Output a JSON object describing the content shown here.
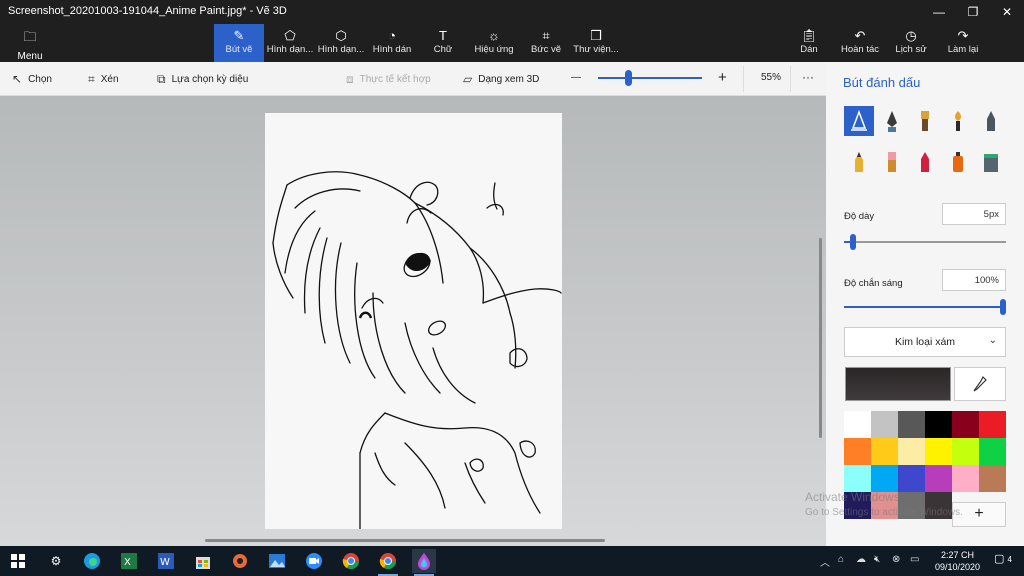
{
  "window": {
    "title": "Screenshot_20201003-191044_Anime Paint.jpg* - Vẽ 3D",
    "minimize": "—",
    "restore": "❐",
    "close": "✕"
  },
  "ribbon": {
    "menu_label": "Menu",
    "tools": [
      {
        "label": "Bút vẽ",
        "icon": "brush-icon"
      },
      {
        "label": "Hình dạn...",
        "icon": "2d-shapes-icon"
      },
      {
        "label": "Hình dạn...",
        "icon": "3d-shapes-icon"
      },
      {
        "label": "Hình dán",
        "icon": "sticker-icon"
      },
      {
        "label": "Chữ",
        "icon": "text-icon"
      },
      {
        "label": "Hiệu ứng",
        "icon": "effects-icon"
      },
      {
        "label": "Bức vẽ",
        "icon": "canvas-icon"
      },
      {
        "label": "Thư viện...",
        "icon": "library-icon"
      }
    ],
    "right_tools": [
      {
        "label": "Dán",
        "icon": "paste-icon"
      },
      {
        "label": "Hoàn tác",
        "icon": "undo-icon"
      },
      {
        "label": "Lịch sử",
        "icon": "history-icon"
      },
      {
        "label": "Làm lại",
        "icon": "redo-icon"
      }
    ]
  },
  "subbar": {
    "select_label": "Chọn",
    "crop_label": "Xén",
    "magic_select_label": "Lựa chọn kỳ diệu",
    "mixed_reality_label": "Thực tế kết hợp",
    "view3d_label": "Dạng xem 3D",
    "zoom_minus": "—",
    "zoom_plus": "+",
    "zoom_value": "55%",
    "zoom_level": 0.28,
    "more": "···"
  },
  "panel": {
    "title": "Bút đánh dấu",
    "thickness_label": "Độ dày",
    "thickness_value": "5px",
    "thickness_level": 0.04,
    "opacity_label": "Độ chắn sáng",
    "opacity_value": "100%",
    "opacity_level": 1.0,
    "texture_label": "Kim loại xám",
    "add_color": "+",
    "palette": [
      "#ffffff",
      "#c3c3c3",
      "#585858",
      "#000000",
      "#88001b",
      "#ec1c24",
      "#ff7f27",
      "#ffca18",
      "#fdeca6",
      "#fff200",
      "#c4ff0e",
      "#0ed145",
      "#8cfffb",
      "#00a8f3",
      "#3f48cc",
      "#b83dba",
      "#ffaec8",
      "#b97a56",
      "#1f1b5c",
      "#e0908f",
      "#6e6e6e",
      "#3b3436",
      "",
      ""
    ]
  },
  "watermark": {
    "line1": "Activate Windows",
    "line2": "Go to Settings to activate Windows."
  },
  "taskbar": {
    "time": "2:27 CH",
    "date": "09/10/2020",
    "notifications": "4"
  }
}
